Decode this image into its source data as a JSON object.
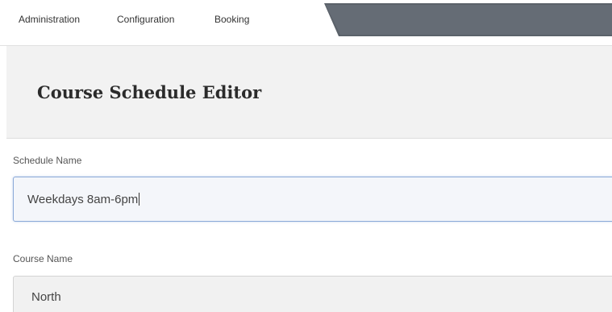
{
  "nav": {
    "items": [
      {
        "label": "Administration"
      },
      {
        "label": "Configuration"
      },
      {
        "label": "Booking"
      }
    ],
    "banner_color": "#646b74"
  },
  "header": {
    "title": "Course Schedule Editor"
  },
  "form": {
    "schedule_name": {
      "label": "Schedule Name",
      "value": "Weekdays 8am-6pm"
    },
    "course_name": {
      "label": "Course Name",
      "value": "North"
    }
  },
  "colors": {
    "focus_border": "#8aa9d8",
    "header_bg": "#f2f2f2"
  }
}
